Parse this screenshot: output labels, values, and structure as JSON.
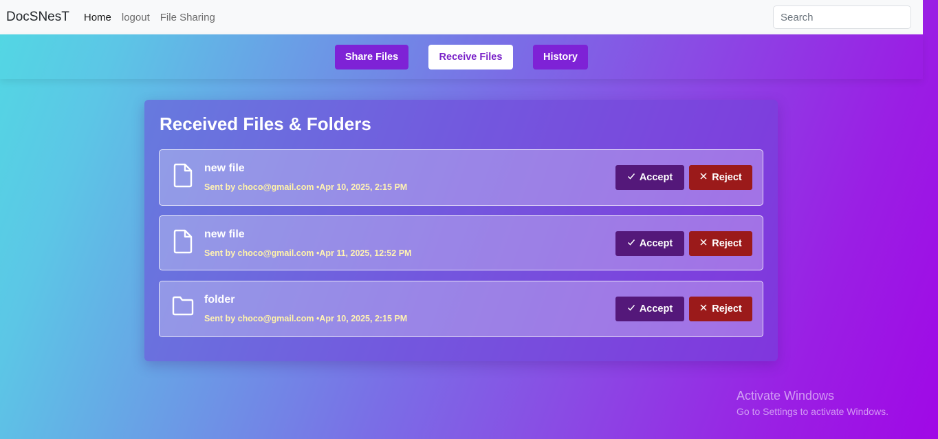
{
  "navbar": {
    "brand": "DocSNesT",
    "links": [
      "Home",
      "logout",
      "File Sharing"
    ],
    "search_placeholder": "Search"
  },
  "tabs": {
    "share": "Share Files",
    "receive": "Receive Files",
    "history": "History"
  },
  "received": {
    "title": "Received Files & Folders",
    "items": [
      {
        "type": "file",
        "icon": "file-icon",
        "name": "new file",
        "sent_by_label": "Sent by",
        "sender": "choco@gmail.com",
        "separator": "•",
        "date": "Apr 10, 2025, 2:15 PM",
        "accept_label": "Accept",
        "reject_label": "Reject"
      },
      {
        "type": "file",
        "icon": "file-icon",
        "name": "new file",
        "sent_by_label": "Sent by",
        "sender": "choco@gmail.com",
        "separator": "•",
        "date": "Apr 11, 2025, 12:52 PM",
        "accept_label": "Accept",
        "reject_label": "Reject"
      },
      {
        "type": "folder",
        "icon": "folder-icon",
        "name": "folder",
        "sent_by_label": "Sent by",
        "sender": "choco@gmail.com",
        "separator": "•",
        "date": "Apr 10, 2025, 2:15 PM",
        "accept_label": "Accept",
        "reject_label": "Reject"
      }
    ]
  },
  "watermark": {
    "title": "Activate Windows",
    "subtitle": "Go to Settings to activate Windows."
  },
  "colors": {
    "accent_purple": "#7e22d6",
    "accept": "#54187a",
    "reject": "#9b1a1a"
  }
}
